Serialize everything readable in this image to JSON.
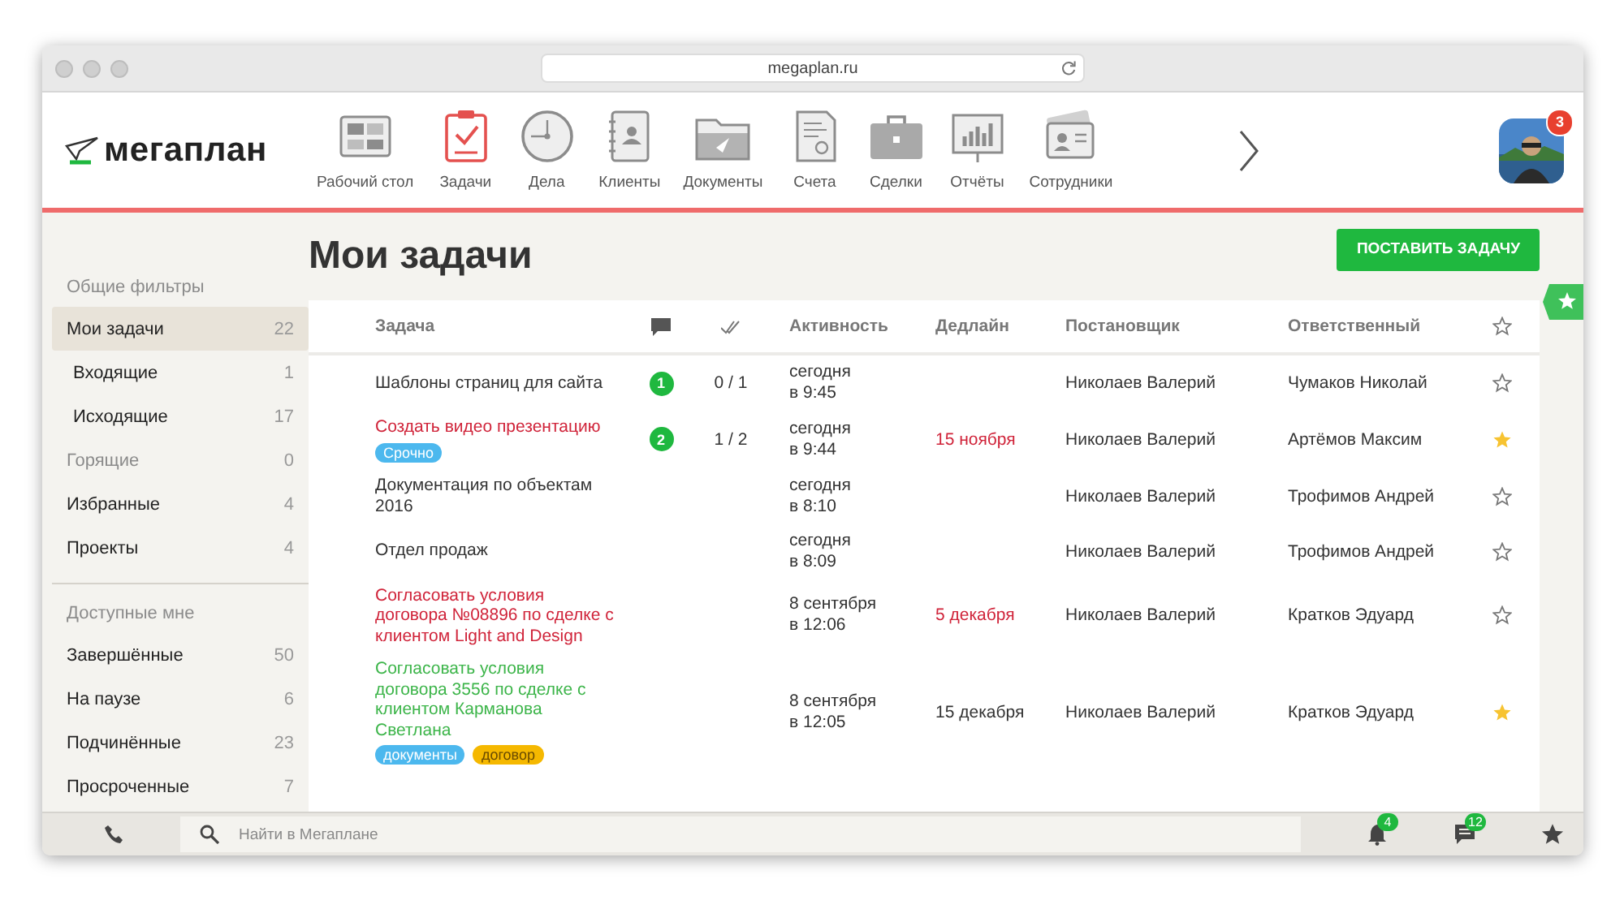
{
  "browser": {
    "address": "megaplan.ru"
  },
  "app": {
    "logo": "мегаплан"
  },
  "nav": [
    {
      "label": "Рабочий стол",
      "selected": false
    },
    {
      "label": "Задачи",
      "selected": true
    },
    {
      "label": "Дела",
      "selected": false
    },
    {
      "label": "Клиенты",
      "selected": false
    },
    {
      "label": "Документы",
      "selected": false
    },
    {
      "label": "Счета",
      "selected": false
    },
    {
      "label": "Сделки",
      "selected": false
    },
    {
      "label": "Отчёты",
      "selected": false
    },
    {
      "label": "Сотрудники",
      "selected": false
    }
  ],
  "user": {
    "badge": "3"
  },
  "sidebar": {
    "groups": [
      {
        "heading": "Общие фильтры",
        "items": [
          {
            "label": "Мои задачи",
            "count": "22",
            "selected": true,
            "disabled": false,
            "children": [
              {
                "label": "Входящие",
                "count": "1",
                "selected": false,
                "disabled": false
              },
              {
                "label": "Исходящие",
                "count": "17",
                "selected": false,
                "disabled": false
              }
            ]
          },
          {
            "label": "Горящие",
            "count": "0",
            "selected": false,
            "disabled": true
          },
          {
            "label": "Избранные",
            "count": "4",
            "selected": false,
            "disabled": false
          },
          {
            "label": "Проекты",
            "count": "4",
            "selected": false,
            "disabled": false
          }
        ]
      },
      {
        "heading": "Доступные мне",
        "items": [
          {
            "label": "Завершённые",
            "count": "50",
            "selected": false,
            "disabled": false
          },
          {
            "label": "На паузе",
            "count": "6",
            "selected": false,
            "disabled": false
          },
          {
            "label": "Подчинённые",
            "count": "23",
            "selected": false,
            "disabled": false
          },
          {
            "label": "Просроченные",
            "count": "7",
            "selected": false,
            "disabled": false
          }
        ]
      }
    ]
  },
  "page": {
    "title": "Мои задачи",
    "action": "ПОСТАВИТЬ ЗАДАЧУ"
  },
  "table": {
    "columns": [
      {
        "kind": "text",
        "label": "Задача"
      },
      {
        "kind": "comments"
      },
      {
        "kind": "checklist"
      },
      {
        "kind": "text",
        "label": "Активность"
      },
      {
        "kind": "text",
        "label": "Дедлайн"
      },
      {
        "kind": "text",
        "label": "Постановщик"
      },
      {
        "kind": "text",
        "label": "Ответственный"
      },
      {
        "kind": "star"
      }
    ],
    "rows": [
      {
        "title": "Шаблоны страниц для сайта",
        "color": "#333333",
        "tags": [],
        "comments": "1",
        "checklist": "0 / 1",
        "activity": "сегодня\nв 9:45",
        "author": "Николаев Валерий",
        "assignee": "Чумаков Николай",
        "starred": false
      },
      {
        "title": "Создать видео презентацию",
        "color": "#d0243a",
        "tags": [
          {
            "label": "Срочно",
            "color": "#4cb8ee"
          }
        ],
        "comments": "2",
        "checklist": "1 / 2",
        "activity": "сегодня\nв 9:44",
        "deadline": "15 ноября",
        "overdue": true,
        "author": "Николаев Валерий",
        "assignee": "Артёмов Максим",
        "starred": true
      },
      {
        "title": "Документация по объектам 2016",
        "color": "#333333",
        "tags": [],
        "activity": "сегодня\nв 8:10",
        "author": "Николаев Валерий",
        "assignee": "Трофимов Андрей",
        "starred": false
      },
      {
        "title": "Отдел продаж",
        "color": "#333333",
        "tags": [],
        "activity": "сегодня\nв 8:09",
        "author": "Николаев Валерий",
        "assignee": "Трофимов Андрей",
        "starred": false
      },
      {
        "title": "Согласовать условия договора №08896 по сделке с клиентом Light and Design",
        "color": "#d0243a",
        "tags": [],
        "activity": "8 сентября\nв 12:06",
        "deadline": "5 декабря",
        "overdue": true,
        "author": "Николаев Валерий",
        "assignee": "Кратков Эдуард",
        "starred": false
      },
      {
        "title": "Согласовать условия договора 3556 по сделке с клиентом Карманова Светлана",
        "color": "#3db54a",
        "tags": [
          {
            "label": "документы",
            "color": "#4cb8ee"
          },
          {
            "label": "договор",
            "color": "#f5b800"
          }
        ],
        "activity": "8 сентября\nв 12:05",
        "deadline": "15 декабря",
        "overdue": false,
        "author": "Николаев Валерий",
        "assignee": "Кратков Эдуард",
        "starred": true
      }
    ]
  },
  "bottom_bar": {
    "search": {
      "placeholder": "Найти в Мегаплане"
    },
    "notifications": "4",
    "messages": "12"
  }
}
